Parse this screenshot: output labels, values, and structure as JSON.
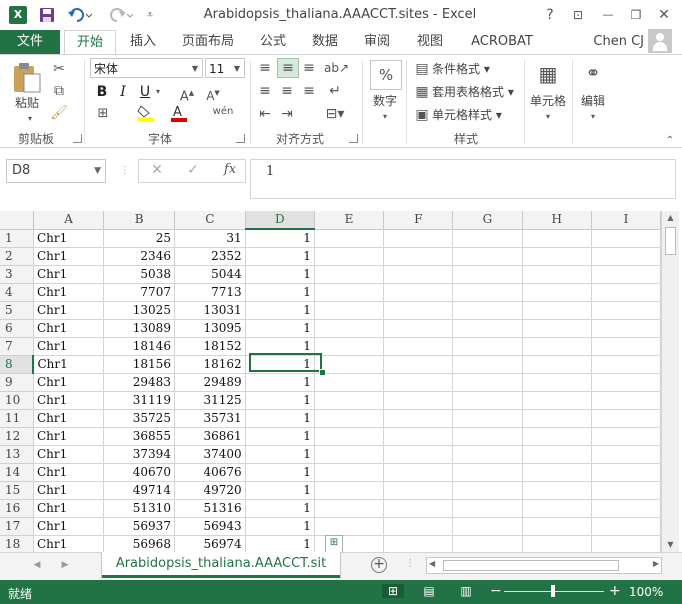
{
  "window": {
    "title": "Arabidopsis_thaliana.AAACCT.sites - Excel",
    "app_logo": "X",
    "controls": {
      "help": "?",
      "ribbon_options": "⊡",
      "minimize": "—",
      "restore": "❐",
      "close": "✕"
    }
  },
  "quick_access": {
    "save_icon": "floppy-icon",
    "undo_icon": "undo-icon",
    "redo_icon": "redo-icon"
  },
  "ribbon": {
    "file_tab": "文件",
    "tabs": [
      "开始",
      "插入",
      "页面布局",
      "公式",
      "数据",
      "审阅",
      "视图",
      "ACROBAT"
    ],
    "active_tab": "开始",
    "user": "Chen CJ",
    "clipboard": {
      "paste": "粘贴",
      "label": "剪贴板"
    },
    "font": {
      "name": "宋体",
      "size": "11",
      "label": "字体",
      "bold": "B",
      "italic": "I",
      "underline": "U"
    },
    "alignment": {
      "label": "对齐方式"
    },
    "number": {
      "format": "数字"
    },
    "styles": {
      "conditional": "条件格式",
      "table": "套用表格格式",
      "cell": "单元格样式",
      "label": "样式"
    },
    "cells": {
      "label": "单元格"
    },
    "editing": {
      "label": "编辑"
    }
  },
  "formula_bar": {
    "name_box": "D8",
    "cancel": "✕",
    "enter": "✓",
    "fx": "fx",
    "value": "1"
  },
  "columns": [
    "A",
    "B",
    "C",
    "D",
    "E",
    "F",
    "G",
    "H",
    "I"
  ],
  "selected_column": "D",
  "selected_row": 8,
  "rows": [
    {
      "n": "1",
      "a": "Chr1",
      "b": "25",
      "c": "31",
      "d": "1"
    },
    {
      "n": "2",
      "a": "Chr1",
      "b": "2346",
      "c": "2352",
      "d": "1"
    },
    {
      "n": "3",
      "a": "Chr1",
      "b": "5038",
      "c": "5044",
      "d": "1"
    },
    {
      "n": "4",
      "a": "Chr1",
      "b": "7707",
      "c": "7713",
      "d": "1"
    },
    {
      "n": "5",
      "a": "Chr1",
      "b": "13025",
      "c": "13031",
      "d": "1"
    },
    {
      "n": "6",
      "a": "Chr1",
      "b": "13089",
      "c": "13095",
      "d": "1"
    },
    {
      "n": "7",
      "a": "Chr1",
      "b": "18146",
      "c": "18152",
      "d": "1"
    },
    {
      "n": "8",
      "a": "Chr1",
      "b": "18156",
      "c": "18162",
      "d": "1"
    },
    {
      "n": "9",
      "a": "Chr1",
      "b": "29483",
      "c": "29489",
      "d": "1"
    },
    {
      "n": "10",
      "a": "Chr1",
      "b": "31119",
      "c": "31125",
      "d": "1"
    },
    {
      "n": "11",
      "a": "Chr1",
      "b": "35725",
      "c": "35731",
      "d": "1"
    },
    {
      "n": "12",
      "a": "Chr1",
      "b": "36855",
      "c": "36861",
      "d": "1"
    },
    {
      "n": "13",
      "a": "Chr1",
      "b": "37394",
      "c": "37400",
      "d": "1"
    },
    {
      "n": "14",
      "a": "Chr1",
      "b": "40670",
      "c": "40676",
      "d": "1"
    },
    {
      "n": "15",
      "a": "Chr1",
      "b": "49714",
      "c": "49720",
      "d": "1"
    },
    {
      "n": "16",
      "a": "Chr1",
      "b": "51310",
      "c": "51316",
      "d": "1"
    },
    {
      "n": "17",
      "a": "Chr1",
      "b": "56937",
      "c": "56943",
      "d": "1"
    },
    {
      "n": "18",
      "a": "Chr1",
      "b": "56968",
      "c": "56974",
      "d": "1"
    }
  ],
  "sheet_tab": "Arabidopsis_thaliana.AAACCT.sit",
  "status": {
    "text": "就绪",
    "zoom": "100%"
  },
  "accent_color": "#217346"
}
